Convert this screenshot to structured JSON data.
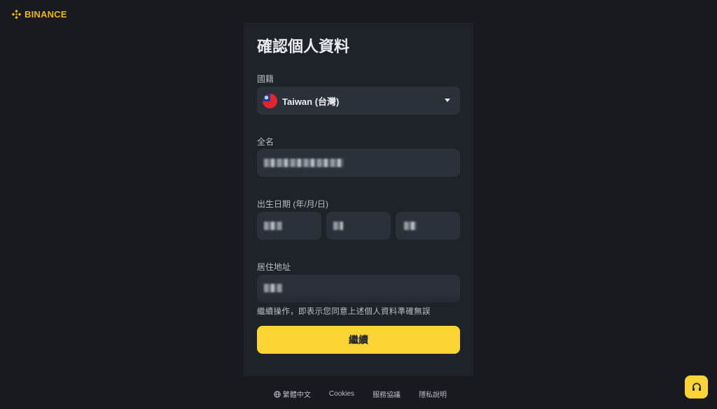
{
  "brand": {
    "name": "BINANCE",
    "color": "#f0b90b"
  },
  "form": {
    "title": "確認個人資料",
    "nationality": {
      "label": "國籍",
      "value": "Taiwan (台灣)",
      "flag_icon": "taiwan-flag-icon"
    },
    "full_name": {
      "label": "全名"
    },
    "dob": {
      "label": "出生日期 (年/月/日)"
    },
    "address": {
      "label": "居住地址"
    },
    "notice": "繼續操作，即表示您同意上述個人資料準確無誤",
    "continue_label": "繼續"
  },
  "footer": {
    "language": "繁體中文",
    "cookies": "Cookies",
    "terms": "服務協議",
    "privacy": "隱私說明"
  },
  "colors": {
    "background": "#181a20",
    "card": "#1e2329",
    "field": "#2b3139",
    "accent": "#fcd535"
  }
}
